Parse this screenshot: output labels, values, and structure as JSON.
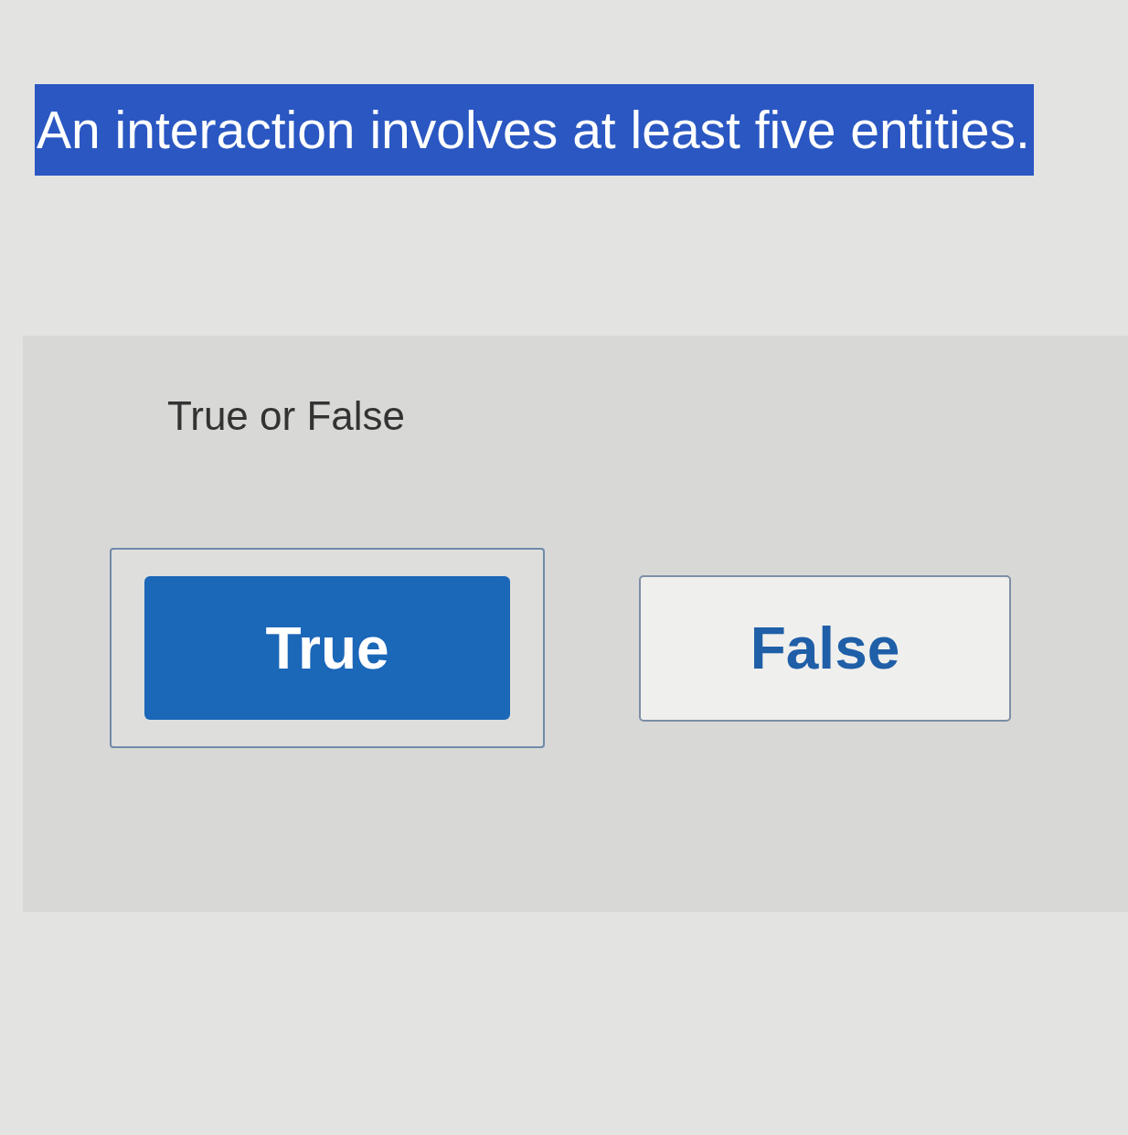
{
  "question": {
    "text": "An interaction involves at least five entities.",
    "highlighted": true
  },
  "prompt": "True or False",
  "options": [
    {
      "label": "True",
      "selected": true
    },
    {
      "label": "False",
      "selected": false
    }
  ]
}
